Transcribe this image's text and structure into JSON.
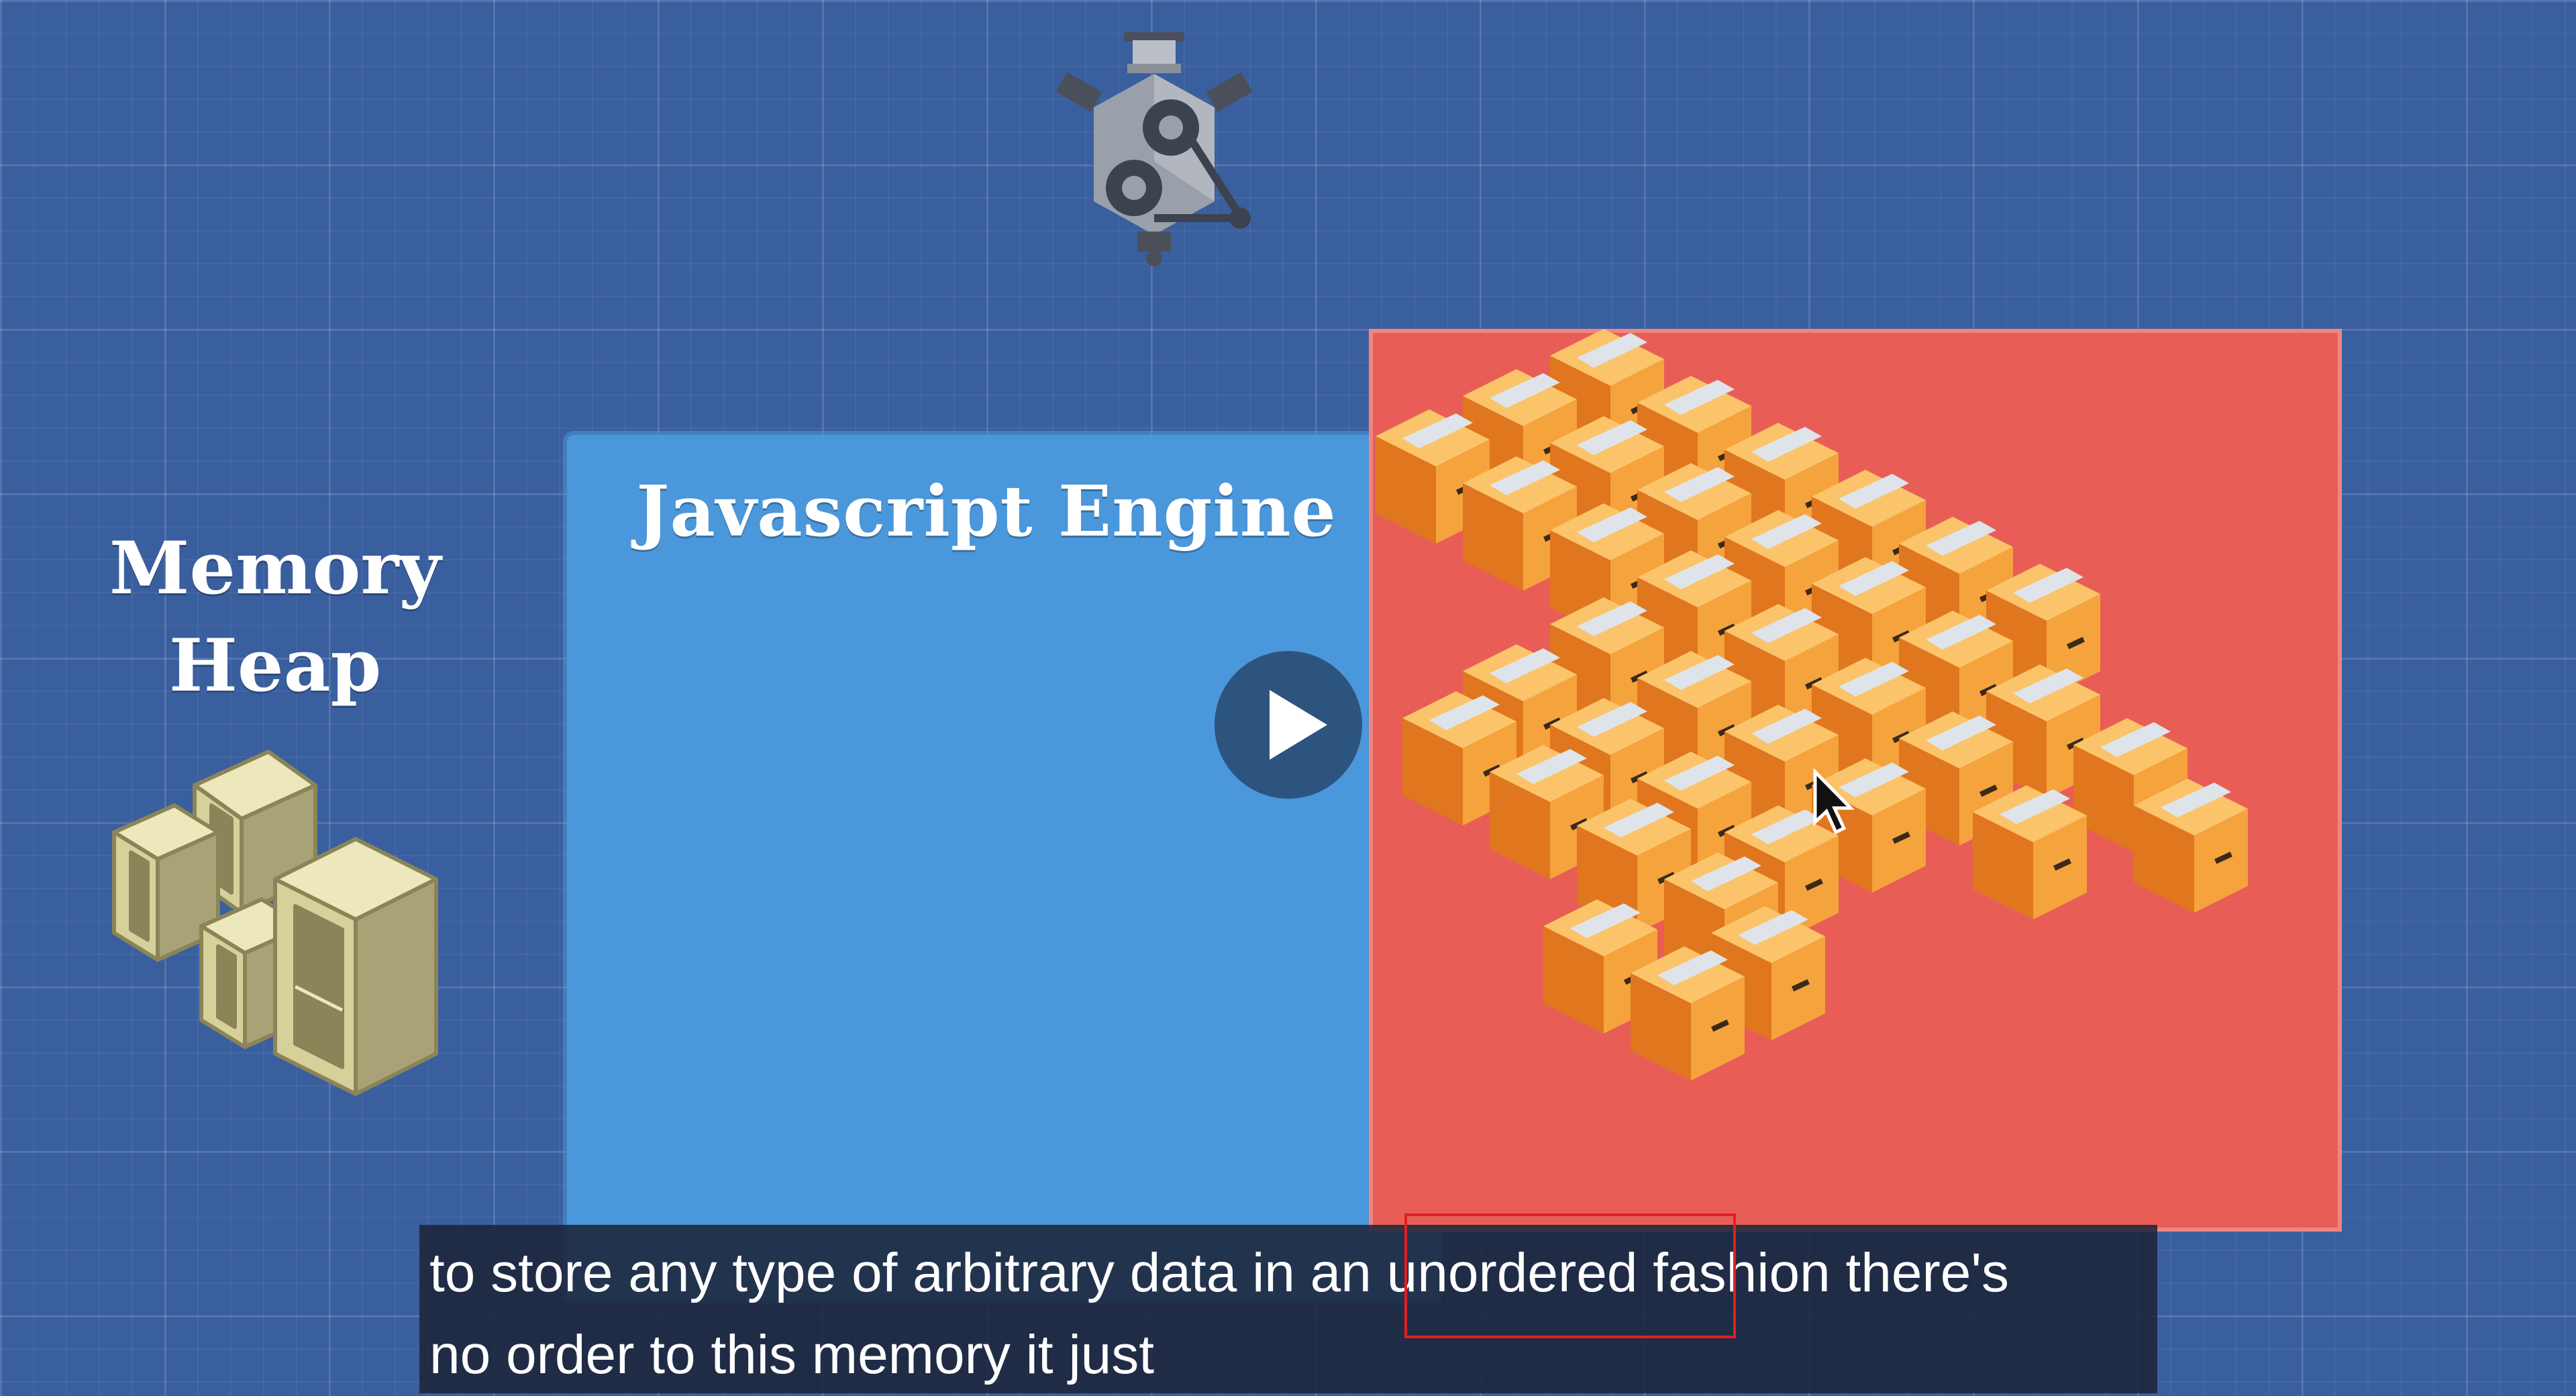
{
  "video": {
    "engine_icon": "engine-icon",
    "memory_heap_icon": "shelves-icon",
    "boxes_icon": "cardboard-boxes-icon",
    "js_engine_title": "Javascript Engine",
    "memory_heap_title_line1": "Memory",
    "memory_heap_title_line2": "Heap",
    "play_icon": "play-icon",
    "cursor_icon": "mouse-pointer-icon"
  },
  "subtitle": {
    "line1": "to store any type of arbitrary data in an unordered fashion there's",
    "line2": "no order to this memory it just"
  },
  "colors": {
    "background": "#3a5f9f",
    "engine_panel": "#4a97db",
    "heap_panel": "#e85e57",
    "box_orange": "#f5a33c",
    "highlight": "#e02020"
  }
}
